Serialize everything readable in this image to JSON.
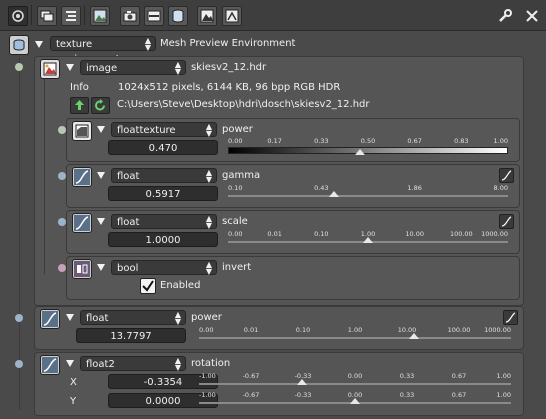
{
  "toolbar": {
    "icons": [
      "render-preview-icon",
      "layers-icon",
      "list-icon",
      "image-icon",
      "camera-icon",
      "film-icon",
      "database-icon",
      "mountain-icon",
      "scene-image-icon",
      "wrench-icon",
      "close-icon"
    ]
  },
  "environment": {
    "type_value": "texture environment",
    "title": "Mesh Preview Environment"
  },
  "image_node": {
    "type_value": "image",
    "filename": "skiesv2_12.hdr",
    "info_label": "Info",
    "info_text": "1024x512 pixels, 6144 KB, 96 bpp RGB HDR",
    "path": "C:\\Users\\Steve\\Desktop\\hdri\\dosch\\skiesv2_12.hdr",
    "power": {
      "type_value": "floattexture",
      "label": "power",
      "value": "0.470",
      "ticks": [
        "0.00",
        "0.17",
        "0.33",
        "0.50",
        "0.67",
        "0.83",
        "1.00"
      ],
      "handle_fraction": 0.47
    },
    "gamma": {
      "type_value": "float",
      "label": "gamma",
      "value": "0.5917",
      "ticks": [
        "0.10",
        "0.43",
        "1.86",
        "8.00"
      ],
      "handle_fraction": 0.38
    },
    "scale": {
      "type_value": "float",
      "label": "scale",
      "value": "1.0000",
      "ticks": [
        "0.00",
        "0.01",
        "0.10",
        "1.00",
        "10.00",
        "100.00",
        "1000.00"
      ],
      "handle_fraction": 0.5
    },
    "invert": {
      "type_value": "bool",
      "label": "invert",
      "checkbox_label": "Enabled",
      "checked": true
    }
  },
  "power_node": {
    "type_value": "float",
    "label": "power",
    "value": "13.7797",
    "ticks": [
      "0.00",
      "0.01",
      "0.10",
      "1.00",
      "10.00",
      "100.00",
      "1000.00"
    ],
    "handle_fraction": 0.69
  },
  "rotation_node": {
    "type_value": "float2",
    "label": "rotation",
    "x_label": "X",
    "x_value": "-0.3354",
    "y_label": "Y",
    "y_value": "0.0000",
    "ticks": [
      "-1.00",
      "-0.67",
      "-0.33",
      "0.00",
      "0.33",
      "0.67",
      "1.00"
    ],
    "x_handle_fraction": 0.33,
    "y_handle_fraction": 0.5
  },
  "colors": {
    "background": "#4a4a4a",
    "panel": "#555555",
    "field": "#2e2e2e",
    "socket_float": "#9fb3c8",
    "socket_texture": "#b8c9b0",
    "socket_bool": "#c8a0b8"
  }
}
